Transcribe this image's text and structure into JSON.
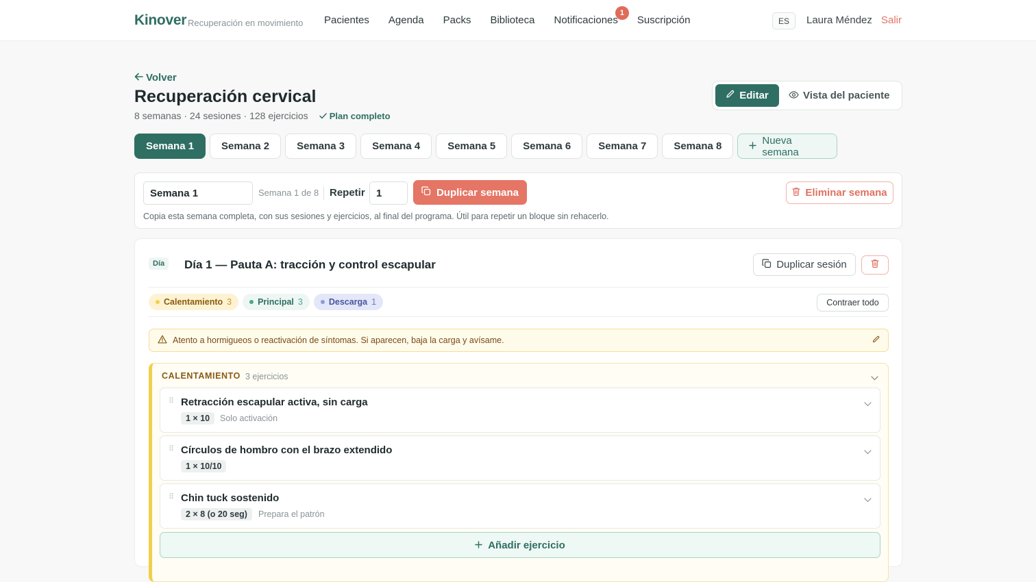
{
  "app": {
    "brand": "Kinover",
    "tagline": "Recuperación en movimiento"
  },
  "nav": {
    "items": [
      "Pacientes",
      "Agenda",
      "Packs",
      "Biblioteca",
      "Notificaciones",
      "Suscripción"
    ],
    "notifications_count": "1",
    "language": "ES",
    "user": "Laura Méndez",
    "logout": "Salir"
  },
  "header": {
    "back": "Volver",
    "title": "Recuperación cervical",
    "meta": "8 semanas · 24 sesiones · 128 ejercicios",
    "status": "Plan completo",
    "edit": "Editar",
    "patient_view": "Vista del paciente"
  },
  "weeks": {
    "tabs": [
      "Semana 1",
      "Semana 2",
      "Semana 3",
      "Semana 4",
      "Semana 5",
      "Semana 6",
      "Semana 7",
      "Semana 8"
    ],
    "active_index": 0,
    "new_week": "Nueva semana"
  },
  "week_toolbar": {
    "name_value": "Semana 1",
    "position": "Semana 1 de 8",
    "repeat_label": "Repetir",
    "repeat_value": "1",
    "duplicate": "Duplicar semana",
    "delete": "Eliminar semana",
    "help": "Copia esta semana completa, con sus sesiones y ejercicios, al final del programa. Útil para repetir un bloque sin rehacerlo."
  },
  "session": {
    "day_badge": "Día",
    "title": "Día 1 — Pauta A: tracción y control escapular",
    "duplicate": "Duplicar sesión",
    "phases": [
      {
        "label": "Calentamiento",
        "count": "3",
        "color": "#f2cf4a",
        "bg": "#fdf3d2",
        "fg": "#8a5a13"
      },
      {
        "label": "Principal",
        "count": "3",
        "color": "#4aa88f",
        "bg": "#eef6f3",
        "fg": "#2f6e63"
      },
      {
        "label": "Descarga",
        "count": "1",
        "color": "#8f9ad8",
        "bg": "#e3e7f7",
        "fg": "#4a55a0"
      }
    ],
    "collapse_all": "Contraer todo",
    "note": "Atento a hormigueos o reactivación de síntomas. Si aparecen, baja la carga y avísame.",
    "block": {
      "title": "CALENTAMIENTO",
      "count": "3 ejercicios",
      "exercises": [
        {
          "name": "Retracción escapular activa, sin carga",
          "dose": "1 × 10",
          "note": "Solo activación"
        },
        {
          "name": "Círculos de hombro con el brazo extendido",
          "dose": "1 × 10/10",
          "note": ""
        },
        {
          "name": "Chin tuck sostenido",
          "dose": "2 × 8 (o 20 seg)",
          "note": "Prepara el patrón"
        }
      ],
      "add_exercise": "Añadir ejercicio"
    }
  }
}
